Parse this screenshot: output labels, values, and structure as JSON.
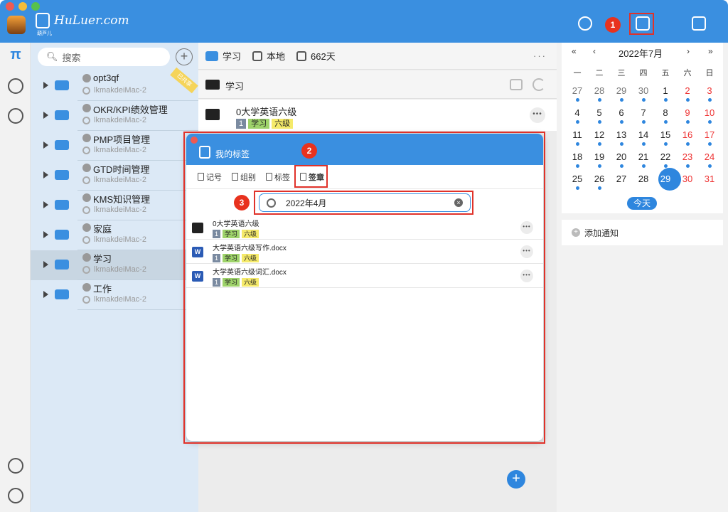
{
  "brand": {
    "name": "HuLuer.com",
    "subtitle": "葫芦儿"
  },
  "annotations": {
    "step1": "1",
    "step2": "2",
    "step3": "3"
  },
  "search": {
    "placeholder": "搜索"
  },
  "workspaces": [
    {
      "name": "opt3qf",
      "device": "lkmakdeiMac-2",
      "ribbon": "已共享"
    },
    {
      "name": "OKR/KPI绩效管理",
      "device": "lkmakdeiMac-2"
    },
    {
      "name": "PMP项目管理",
      "device": "lkmakdeiMac-2"
    },
    {
      "name": "GTD时间管理",
      "device": "lkmakdeiMac-2"
    },
    {
      "name": "KMS知识管理",
      "device": "lkmakdeiMac-2"
    },
    {
      "name": "家庭",
      "device": "lkmakdeiMac-2"
    },
    {
      "name": "学习",
      "device": "lkmakdeiMac-2"
    },
    {
      "name": "工作",
      "device": "lkmakdeiMac-2"
    }
  ],
  "center": {
    "tabs": {
      "workspace": "学习",
      "location": "本地",
      "days": "662天"
    },
    "more": "···",
    "folder_title": "学习",
    "item": {
      "title": "0大学英语六级",
      "tag_num": "1",
      "tag_a": "学习",
      "tag_b": "六级"
    },
    "fab": "+"
  },
  "calendar": {
    "nav": {
      "prev_year": "«",
      "prev_month": "‹",
      "next_month": "›",
      "next_year": "»"
    },
    "title": "2022年7月",
    "weekdays": [
      "一",
      "二",
      "三",
      "四",
      "五",
      "六",
      "日"
    ],
    "days": [
      "27",
      "28",
      "29",
      "30",
      "1",
      "2",
      "3",
      "4",
      "5",
      "6",
      "7",
      "8",
      "9",
      "10",
      "11",
      "12",
      "13",
      "14",
      "15",
      "16",
      "17",
      "18",
      "19",
      "20",
      "21",
      "22",
      "23",
      "24",
      "25",
      "26",
      "27",
      "28",
      "29",
      "30",
      "31"
    ],
    "today_label": "今天",
    "add_notify": "添加通知"
  },
  "dialog": {
    "title": "我的标签",
    "tabs": [
      "记号",
      "组别",
      "标签",
      "签章"
    ],
    "search_value": "2022年4月",
    "results": [
      {
        "name": "0大学英语六级",
        "type": "folder",
        "tag_num": "1",
        "tag_a": "学习",
        "tag_b": "六级"
      },
      {
        "name": "大学英语六级写作.docx",
        "type": "word",
        "tag_num": "1",
        "tag_a": "学习",
        "tag_b": "六级"
      },
      {
        "name": "大学英语六级词汇.docx",
        "type": "word",
        "tag_num": "1",
        "tag_a": "学习",
        "tag_b": "六级"
      }
    ]
  },
  "colors": {
    "accent": "#3a8fe0",
    "sidebar": "#dce9f6",
    "annotation": "#e8321e"
  }
}
